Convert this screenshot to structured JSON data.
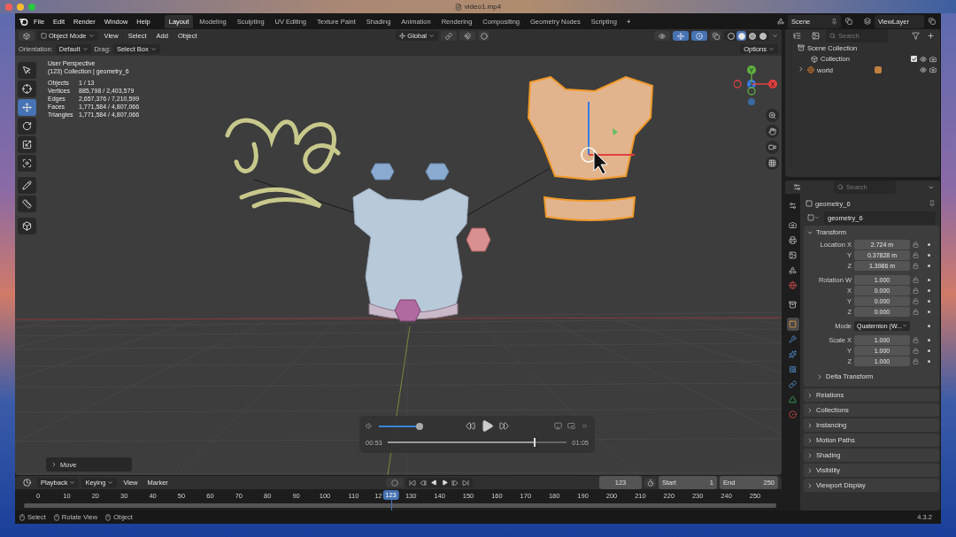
{
  "titlebar": {
    "title": "video1.mp4"
  },
  "menu": [
    "File",
    "Edit",
    "Render",
    "Window",
    "Help"
  ],
  "workspaces": [
    {
      "label": "Layout",
      "selected": true
    },
    {
      "label": "Modeling",
      "selected": false
    },
    {
      "label": "Sculpting",
      "selected": false
    },
    {
      "label": "UV Editing",
      "selected": false
    },
    {
      "label": "Texture Paint",
      "selected": false
    },
    {
      "label": "Shading",
      "selected": false
    },
    {
      "label": "Animation",
      "selected": false
    },
    {
      "label": "Rendering",
      "selected": false
    },
    {
      "label": "Compositing",
      "selected": false
    },
    {
      "label": "Geometry Nodes",
      "selected": false
    },
    {
      "label": "Scripting",
      "selected": false
    }
  ],
  "add_workspace": "+",
  "scene": {
    "value": "Scene"
  },
  "view_layer": {
    "value": "ViewLayer"
  },
  "viewport": {
    "header": {
      "mode": "Object Mode",
      "menus": [
        "View",
        "Select",
        "Add",
        "Object"
      ],
      "transform_orientation": "Global",
      "shading": [
        {
          "selected": false
        },
        {
          "selected": true
        },
        {
          "selected": false
        },
        {
          "selected": false
        }
      ]
    },
    "tool_settings": {
      "orientation_label": "Orientation:",
      "orientation": "Default",
      "drag_label": "Drag:",
      "drag": "Select Box",
      "options": "Options"
    },
    "tools": [
      {
        "selected": false
      },
      {
        "selected": false
      },
      {
        "selected": true
      },
      {
        "selected": false
      },
      {
        "selected": false
      },
      {
        "selected": false
      },
      {
        "selected": false
      },
      {
        "selected": false
      },
      {
        "selected": false
      }
    ],
    "overlay": {
      "title": "User Perspective",
      "context": "(123) Collection | geometry_6",
      "stats": [
        {
          "label": "Objects",
          "value": "1 / 13"
        },
        {
          "label": "Vertices",
          "value": "885,798 / 2,403,579"
        },
        {
          "label": "Edges",
          "value": "2,657,376 / 7,210,599"
        },
        {
          "label": "Faces",
          "value": "1,771,584 / 4,807,066"
        },
        {
          "label": "Triangles",
          "value": "1,771,584 / 4,807,066"
        }
      ]
    },
    "gizmo_axes": [
      "X",
      "Y",
      "Z"
    ],
    "last_operator": {
      "label": "Move",
      "expanded": false
    }
  },
  "player": {
    "volume": {
      "level": 1
    },
    "elapsed": "00:53",
    "duration": "01:05",
    "progress": {
      "level": 0.815
    }
  },
  "outliner": {
    "search": {
      "placeholder": "Search"
    },
    "tree": [
      {
        "label": "Scene Collection",
        "children": [
          {
            "label": "Collection",
            "checked": true
          },
          {
            "label": "world",
            "expanded": false
          }
        ]
      }
    ]
  },
  "properties": {
    "search": {
      "placeholder": "Search"
    },
    "tabs": [
      {
        "selected": false
      },
      {
        "selected": false
      },
      {
        "selected": false
      },
      {
        "selected": false
      },
      {
        "selected": false
      },
      {
        "selected": false
      },
      {
        "selected": false
      },
      {
        "selected": true
      },
      {
        "selected": false
      },
      {
        "selected": false
      },
      {
        "selected": false
      },
      {
        "selected": false
      },
      {
        "selected": false
      },
      {
        "selected": false
      }
    ],
    "object_name": "geometry_6",
    "datablock": "geometry_6",
    "transform": {
      "label": "Transform",
      "expanded": true,
      "groups": [
        {
          "rows": [
            {
              "kind": "field",
              "label": "Location X",
              "value": "2.724 m"
            },
            {
              "kind": "field",
              "label": "Y",
              "value": "0.37828 m"
            },
            {
              "kind": "field",
              "label": "Z",
              "value": "1.3986 m"
            }
          ]
        },
        {
          "rows": [
            {
              "kind": "field",
              "label": "Rotation W",
              "value": "1.000"
            },
            {
              "kind": "field",
              "label": "X",
              "value": "0.000"
            },
            {
              "kind": "field",
              "label": "Y",
              "value": "0.000"
            },
            {
              "kind": "field",
              "label": "Z",
              "value": "0.000"
            }
          ]
        },
        {
          "rows": [
            {
              "kind": "dropdown",
              "label": "Mode",
              "value": "Quaternion (W..."
            }
          ]
        },
        {
          "rows": [
            {
              "kind": "field",
              "label": "Scale X",
              "value": "1.000"
            },
            {
              "kind": "field",
              "label": "Y",
              "value": "1.000"
            },
            {
              "kind": "field",
              "label": "Z",
              "value": "1.000"
            }
          ]
        }
      ],
      "subpanels": [
        {
          "label": "Delta Transform",
          "expanded": false
        }
      ]
    },
    "panels": [
      {
        "label": "Relations",
        "expanded": false
      },
      {
        "label": "Collections",
        "expanded": false
      },
      {
        "label": "Instancing",
        "expanded": false
      },
      {
        "label": "Motion Paths",
        "expanded": false
      },
      {
        "label": "Shading",
        "expanded": false
      },
      {
        "label": "Visibility",
        "expanded": false
      },
      {
        "label": "Viewport Display",
        "expanded": false
      }
    ]
  },
  "timeline": {
    "menus": [
      {
        "label": "Playback",
        "kind": "dropdown"
      },
      {
        "label": "Keying",
        "kind": "dropdown"
      },
      {
        "label": "View",
        "kind": "menu"
      },
      {
        "label": "Marker",
        "kind": "menu"
      }
    ],
    "current_frame": "123",
    "start_label": "Start",
    "start": "1",
    "end_label": "End",
    "end": "250",
    "ticks": [
      "0",
      "10",
      "20",
      "30",
      "40",
      "50",
      "60",
      "70",
      "80",
      "90",
      "100",
      "110",
      "12",
      "130",
      "140",
      "150",
      "160",
      "170",
      "180",
      "190",
      "200",
      "210",
      "220",
      "230",
      "240",
      "250"
    ],
    "playhead": "123"
  },
  "status_bar": {
    "hints": [
      "Select",
      "Rotate View",
      "Object"
    ],
    "version": "4.3.2"
  }
}
